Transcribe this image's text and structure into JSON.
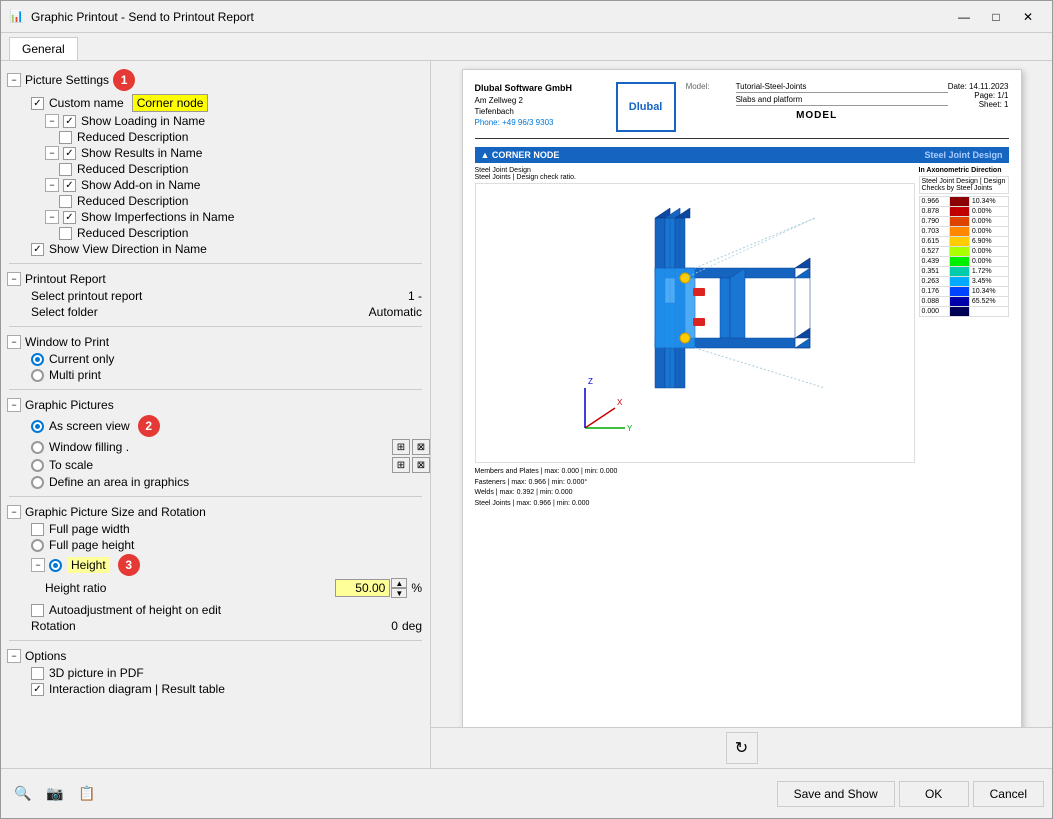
{
  "window": {
    "title": "Graphic Printout - Send to Printout Report",
    "icon": "📊"
  },
  "tabs": [
    {
      "label": "General",
      "active": true
    }
  ],
  "title_buttons": {
    "minimize": "—",
    "maximize": "□",
    "close": "✕"
  },
  "picture_settings": {
    "section_label": "Picture Settings",
    "badge": "1",
    "custom_name": {
      "label": "Custom name",
      "checked": true,
      "value": "Corner node"
    },
    "show_loading": {
      "label": "Show Loading in Name",
      "checked": true
    },
    "reduced_desc_1": {
      "label": "Reduced Description",
      "checked": false
    },
    "show_results": {
      "label": "Show Results in Name",
      "checked": true
    },
    "reduced_desc_2": {
      "label": "Reduced Description",
      "checked": false
    },
    "show_addon": {
      "label": "Show Add-on in Name",
      "checked": true
    },
    "reduced_desc_3": {
      "label": "Reduced Description",
      "checked": false
    },
    "show_imperfections": {
      "label": "Show Imperfections in Name",
      "checked": true
    },
    "reduced_desc_4": {
      "label": "Reduced Description",
      "checked": false
    },
    "show_view": {
      "label": "Show View Direction in Name",
      "checked": true
    }
  },
  "printout_report": {
    "section_label": "Printout Report",
    "select_report": {
      "label": "Select printout report",
      "value": "1 -"
    },
    "select_folder": {
      "label": "Select folder",
      "value": "Automatic"
    }
  },
  "window_to_print": {
    "section_label": "Window to Print",
    "current_only": {
      "label": "Current only",
      "checked": true
    },
    "multi_print": {
      "label": "Multi print",
      "checked": false
    }
  },
  "graphic_pictures": {
    "section_label": "Graphic Pictures",
    "badge": "2",
    "as_screen": {
      "label": "As screen view",
      "checked": true
    },
    "window_filling": {
      "label": "Window filling .",
      "checked": false
    },
    "to_scale": {
      "label": "To scale",
      "checked": false
    },
    "define_area": {
      "label": "Define an area in graphics",
      "checked": false
    }
  },
  "graphic_size": {
    "section_label": "Graphic Picture Size and Rotation",
    "full_page_width": {
      "label": "Full page width",
      "checked": false
    },
    "full_page_height": {
      "label": "Full page height",
      "checked": false
    },
    "height": {
      "label": "Height",
      "checked": true,
      "badge": "3"
    },
    "height_ratio": {
      "label": "Height ratio",
      "value": "50.00",
      "unit": "%"
    },
    "autoadjustment": {
      "label": "Autoadjustment of height on edit",
      "checked": false
    },
    "rotation": {
      "label": "Rotation",
      "value": "0",
      "unit": "deg"
    }
  },
  "options": {
    "section_label": "Options",
    "picture_3d": {
      "label": "3D picture in PDF",
      "checked": false
    },
    "interaction": {
      "label": "Interaction diagram | Result table",
      "checked": true
    }
  },
  "preview": {
    "company": {
      "name": "Dlubal Software GmbH",
      "address1": "Am Zellweg 2",
      "city": "Tiefenbach",
      "phone": "Phone: +49 96/3 9303"
    },
    "logo": "Dlubal",
    "model": {
      "label": "Model:",
      "value": "Tutorial-Steel-Joints",
      "sublabel": "Slabs and platform"
    },
    "date_label": "Date: 14.11.2023",
    "page_label": "Page: 1/1",
    "sheet_label": "Sheet: 1",
    "model_title": "MODEL",
    "section_title": "CORNER NODE",
    "section_subtitle": "Steel Joint Design",
    "legend": {
      "title1": "Steel Joint Design | Design",
      "title2": "Checks by Steel Joints",
      "direction": "In Axonometric Direction",
      "rows": [
        {
          "value": "0.966",
          "color": "#8b0000",
          "percent": "10.34%"
        },
        {
          "value": "0.878",
          "color": "#c00000",
          "percent": "0.00%"
        },
        {
          "value": "0.790",
          "color": "#dd4400",
          "percent": "0.00%"
        },
        {
          "value": "0.703",
          "color": "#ff8800",
          "percent": "0.00%"
        },
        {
          "value": "0.615",
          "color": "#ffcc00",
          "percent": "6.90%"
        },
        {
          "value": "0.527",
          "color": "#aaff00",
          "percent": "0.00%"
        },
        {
          "value": "0.439",
          "color": "#00ee00",
          "percent": "0.00%"
        },
        {
          "value": "0.351",
          "color": "#00ccaa",
          "percent": "1.72%"
        },
        {
          "value": "0.263",
          "color": "#00aaff",
          "percent": "3.45%"
        },
        {
          "value": "0.176",
          "color": "#0044ff",
          "percent": "10.34%"
        },
        {
          "value": "0.088",
          "color": "#0000aa",
          "percent": "65.52%"
        },
        {
          "value": "0.000",
          "color": "#000055",
          "percent": ""
        }
      ]
    },
    "caption": {
      "line1": "Members and Plates | max: 0.000 | min: 0.000",
      "line2": "Fasteners | max: 0.966 | min: 0.000°",
      "line3": "Welds | max: 0.392 | min: 0.000",
      "line4": "Steel Joints | max: 0.966 | min: 0.000"
    }
  },
  "bottom_tools": [
    {
      "name": "search-tool",
      "icon": "🔍"
    },
    {
      "name": "camera-tool",
      "icon": "📷"
    },
    {
      "name": "report-tool",
      "icon": "📋"
    }
  ],
  "buttons": {
    "save_show": "Save and Show",
    "ok": "OK",
    "cancel": "Cancel"
  }
}
